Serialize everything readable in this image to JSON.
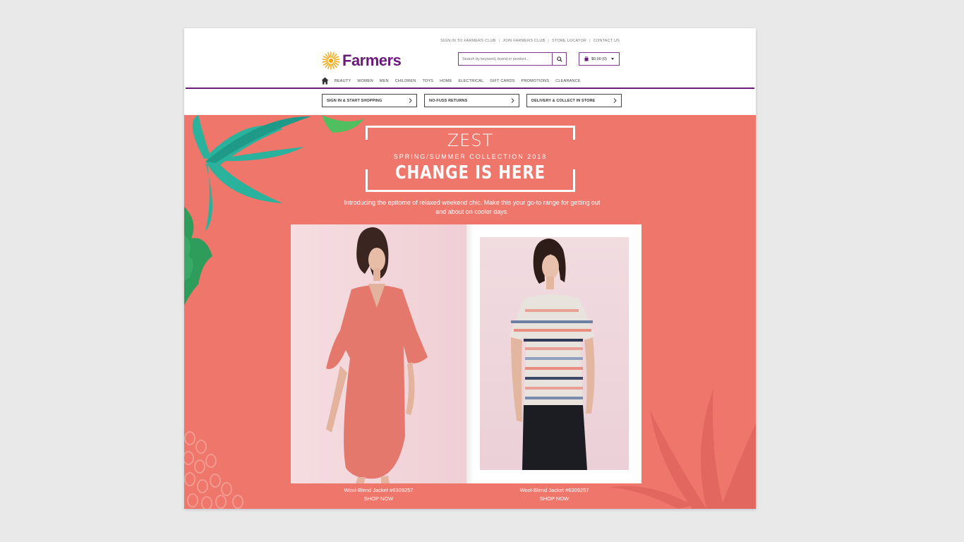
{
  "utility": {
    "sign_in": "SIGN IN TO FARMERS CLUB",
    "join": "JOIN FARMERS CLUB",
    "store_locator": "STORE LOCATOR",
    "contact": "CONTACT US"
  },
  "brand": {
    "name": "Farmers",
    "color": "#6a1b7a"
  },
  "search": {
    "placeholder": "Search by keyword, brand or product..."
  },
  "cart": {
    "label": "$0.00 (0)"
  },
  "nav": {
    "items": [
      "BEAUTY",
      "WOMEN",
      "MEN",
      "CHILDREN",
      "TOYS",
      "HOME",
      "ELECTRICAL",
      "GIFT CARDS",
      "PROMOTIONS",
      "CLEARANCE"
    ]
  },
  "promos": [
    {
      "label": "SIGN IN & START SHOPPING"
    },
    {
      "label": "NO-FUSS RETURNS"
    },
    {
      "label": "DELIVERY & COLLECT IN STORE"
    }
  ],
  "hero": {
    "background": "#ee766b",
    "eyebrow": "ZEST",
    "season": "SPRING/SUMMER COLLECTION 2018",
    "headline": "CHANGE IS HERE",
    "intro": "Introducing the epitome of relaxed weekend chic. Make this your go-to range for getting out and about on cooler days."
  },
  "products": [
    {
      "name": "Wool-Blend Jacket #6309257",
      "cta": "SHOP NOW"
    },
    {
      "name": "Wool-Blend Jacket #6309257",
      "cta": "SHOP NOW"
    }
  ]
}
